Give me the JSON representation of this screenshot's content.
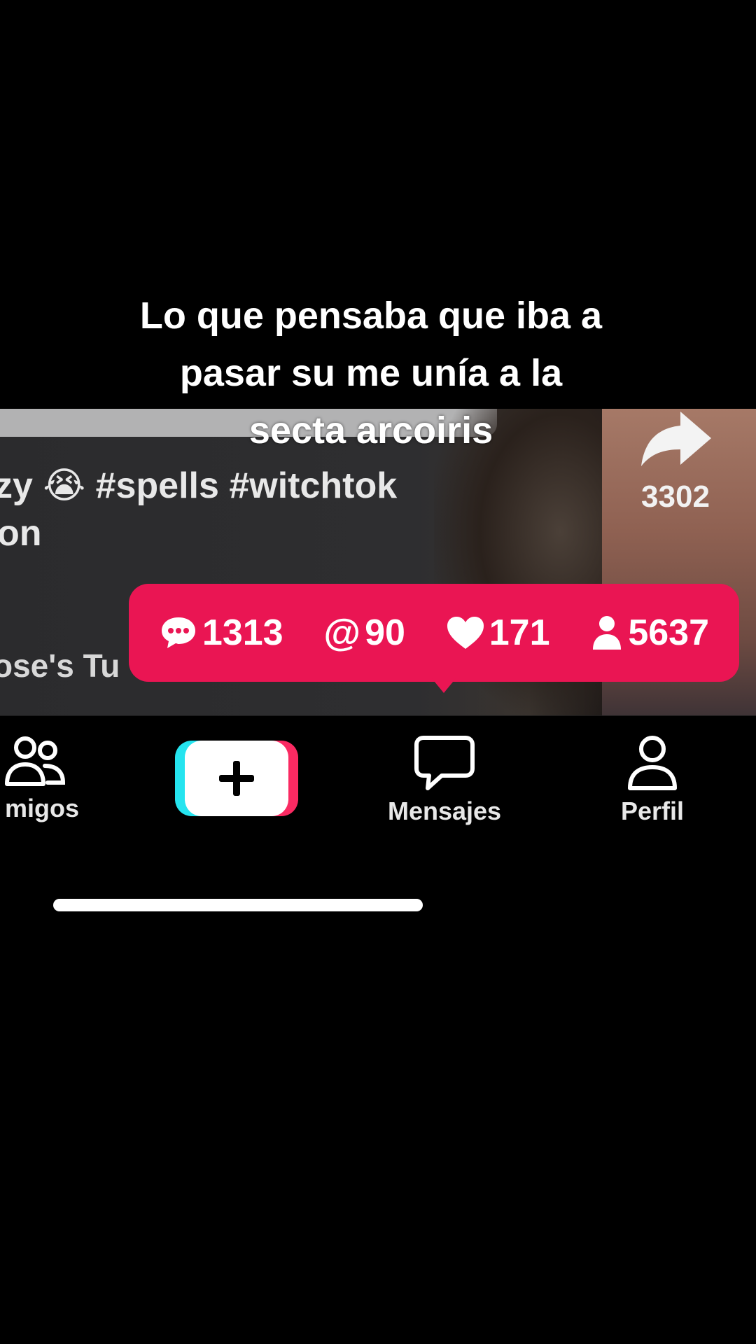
{
  "overlay": {
    "line1": "Lo que pensaba que iba a",
    "line2": "pasar su me unía a la",
    "line3": "secta arcoiris"
  },
  "video": {
    "caption_line1": "zy 😭 #spells #witchtok",
    "caption_line2": "on",
    "author": "ose's Tu",
    "share_count": "3302"
  },
  "stats": {
    "comments": "1313",
    "mentions": "90",
    "likes": "171",
    "followers": "5637",
    "accent": "#ea1553"
  },
  "nav": {
    "friends": "migos",
    "messages": "Mensajes",
    "profile": "Perfil"
  },
  "icons": [
    "share-icon",
    "comment-bubble-icon",
    "at-icon",
    "heart-icon",
    "person-icon",
    "friends-icon",
    "create-plus-icon",
    "messages-icon",
    "profile-icon"
  ]
}
